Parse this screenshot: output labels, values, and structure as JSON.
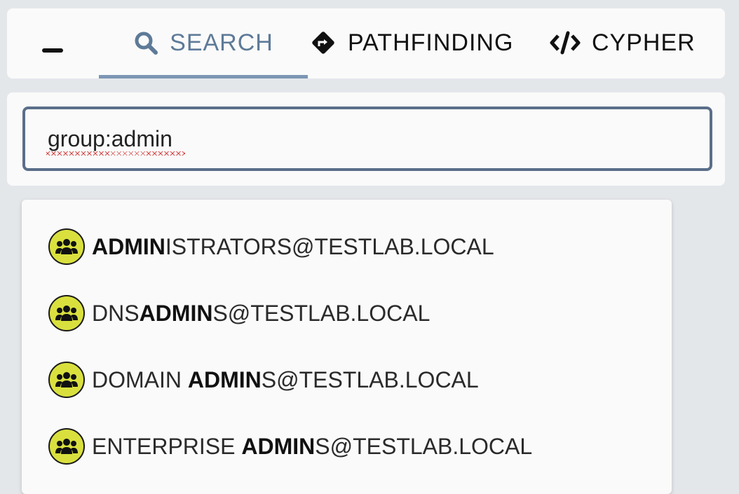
{
  "tabs": {
    "search": {
      "label": "SEARCH",
      "icon": "search-icon"
    },
    "pathfinding": {
      "label": "PATHFINDING",
      "icon": "directions-icon"
    },
    "cypher": {
      "label": "CYPHER",
      "icon": "code-icon"
    }
  },
  "search": {
    "value": "group:admin"
  },
  "colors": {
    "accent": "#5e7a98",
    "group_icon": "#d9e03e",
    "input_border": "#5a6e89"
  },
  "results": [
    {
      "pre": "",
      "match": "ADMIN",
      "post": "ISTRATORS@TESTLAB.LOCAL",
      "icon": "group-icon"
    },
    {
      "pre": "DNS",
      "match": "ADMIN",
      "post": "S@TESTLAB.LOCAL",
      "icon": "group-icon"
    },
    {
      "pre": "DOMAIN ",
      "match": "ADMIN",
      "post": "S@TESTLAB.LOCAL",
      "icon": "group-icon"
    },
    {
      "pre": "ENTERPRISE ",
      "match": "ADMIN",
      "post": "S@TESTLAB.LOCAL",
      "icon": "group-icon"
    }
  ]
}
